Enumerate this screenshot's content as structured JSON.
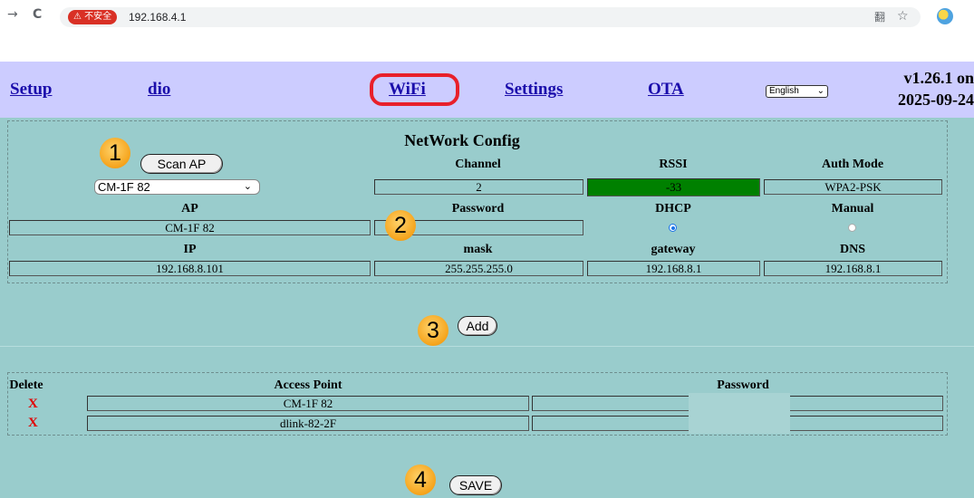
{
  "browser": {
    "back_icon": "→",
    "reload_icon": "C",
    "security_badge": "⚠ 不安全",
    "url": "192.168.4.1",
    "translate_icon": "翻",
    "star_icon": "☆"
  },
  "nav": {
    "setup": "Setup",
    "dio": "dio",
    "wifi": "WiFi",
    "settings": "Settings",
    "ota": "OTA",
    "language": "English",
    "version_line1": "v1.26.1 on",
    "version_line2": "2025-09-24"
  },
  "network_config": {
    "title": "NetWork Config",
    "scan_button": "Scan AP",
    "ap_select": "CM-1F 82",
    "headers": {
      "channel": "Channel",
      "rssi": "RSSI",
      "auth_mode": "Auth Mode",
      "ap": "AP",
      "password": "Password",
      "dhcp": "DHCP",
      "manual": "Manual",
      "ip": "IP",
      "mask": "mask",
      "gateway": "gateway",
      "dns": "DNS"
    },
    "channel": "2",
    "rssi": "-33",
    "rssi_color": "#008000",
    "auth_mode": "WPA2-PSK",
    "ap": "CM-1F 82",
    "password": "",
    "dhcp_selected": true,
    "manual_selected": false,
    "ip": "192.168.8.101",
    "mask": "255.255.255.0",
    "gateway": "192.168.8.1",
    "dns": "192.168.8.1"
  },
  "add_button": "Add",
  "saved_aps": {
    "headers": {
      "delete": "Delete",
      "access_point": "Access Point",
      "password": "Password"
    },
    "rows": [
      {
        "delete": "X",
        "access_point": "CM-1F 82",
        "password": ""
      },
      {
        "delete": "X",
        "access_point": "dlink-82-2F",
        "password": ""
      }
    ]
  },
  "save_button": "SAVE",
  "step_badges": [
    "1",
    "2",
    "3",
    "4"
  ]
}
